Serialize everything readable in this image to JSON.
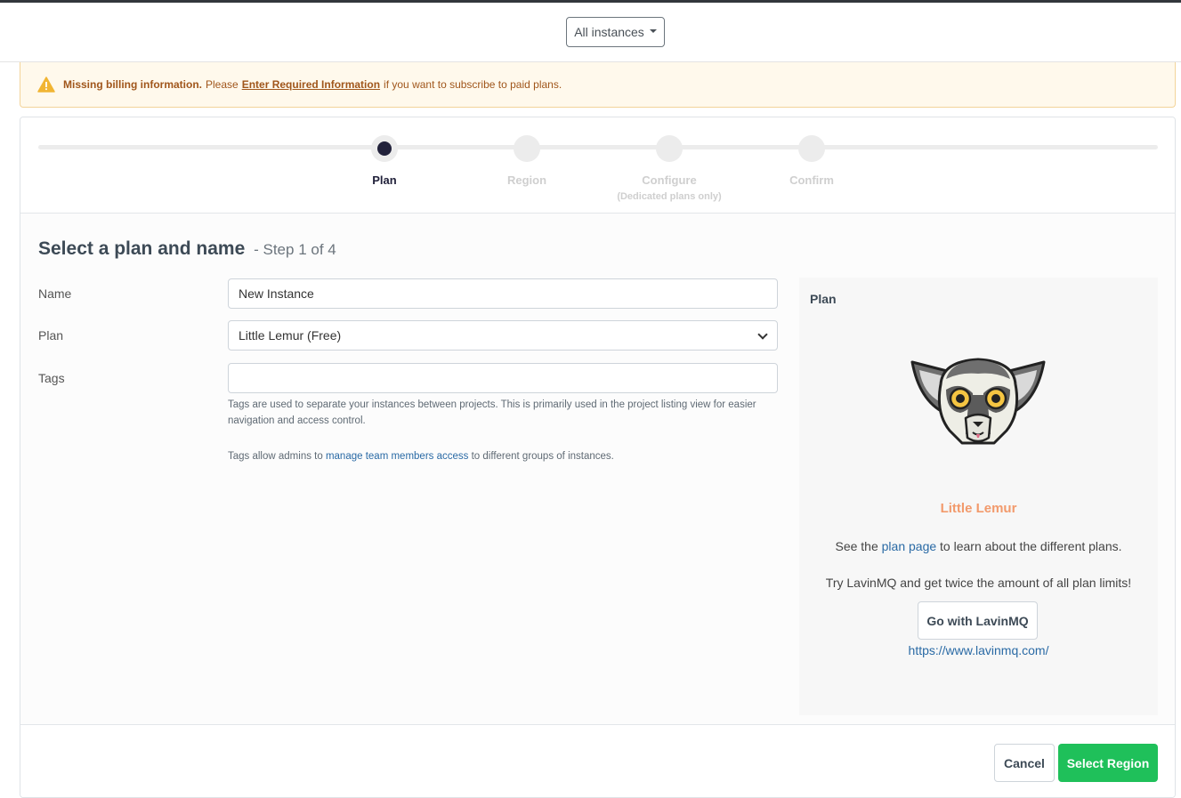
{
  "header": {
    "instances_dropdown": "All instances"
  },
  "alert": {
    "bold_text": "Missing billing information.",
    "pre_link": "Please",
    "link": "Enter Required Information",
    "post_link": "if you want to subscribe to paid plans.",
    "icon": "warning-icon"
  },
  "stepper": {
    "steps": [
      {
        "label": "Plan",
        "sub": "",
        "state": "current"
      },
      {
        "label": "Region",
        "sub": "",
        "state": "pending"
      },
      {
        "label": "Configure",
        "sub": "(Dedicated plans only)",
        "state": "pending"
      },
      {
        "label": "Confirm",
        "sub": "",
        "state": "pending"
      }
    ]
  },
  "form": {
    "heading": "Select a plan and name",
    "step_of": "- Step 1 of 4",
    "name_label": "Name",
    "name_value": "New Instance",
    "plan_label": "Plan",
    "plan_value": "Little Lemur (Free)",
    "tags_label": "Tags",
    "tags_value": "",
    "tags_help_1": "Tags are used to separate your instances between projects. This is primarily used in the project listing view for easier navigation and access control.",
    "tags_help_2_pre": "Tags allow admins to",
    "tags_help_2_link": "manage team members access",
    "tags_help_2_post": "to different groups of instances."
  },
  "plan_panel": {
    "title": "Plan",
    "plan_name": "Little Lemur",
    "see_pre": "See the",
    "see_link": "plan page",
    "see_post": "to learn about the different plans.",
    "lavin_text": "Try LavinMQ and get twice the amount of all plan limits!",
    "lavin_button": "Go with LavinMQ",
    "lavin_url": "https://www.lavinmq.com/",
    "image": "lemur-mascot-icon"
  },
  "footer": {
    "cancel": "Cancel",
    "next": "Select Region"
  },
  "colors": {
    "accent_green": "#1fc05a",
    "plan_name_orange": "#f29a6c",
    "link_blue": "#2a6aa5",
    "alert_brown": "#a0561b",
    "step_active": "#22223b"
  }
}
